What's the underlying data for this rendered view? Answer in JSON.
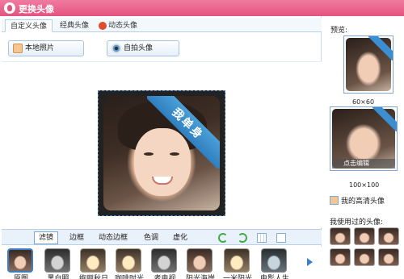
{
  "window": {
    "title": "更换头像"
  },
  "tabs": [
    "自定义头像",
    "经典头像",
    "动态头像"
  ],
  "toolbar": {
    "local_photo": "本地照片",
    "selfie": "自拍头像"
  },
  "photo": {
    "ribbon_text": "我单身"
  },
  "filter_tabs": [
    "滤镜",
    "边框",
    "动态边框",
    "色调",
    "虚化"
  ],
  "filters": [
    "原图",
    "黑白照",
    "绚丽秋日",
    "咖啡时光",
    "老电视",
    "阳光海岸",
    "一米阳光",
    "电影人生"
  ],
  "preview": {
    "label": "预览:",
    "small_size": "60×60",
    "large_size": "100×100",
    "edit_caption": "点击编辑",
    "hd_link": "我的高清头像"
  },
  "history": {
    "label": "我使用过的头像:"
  }
}
